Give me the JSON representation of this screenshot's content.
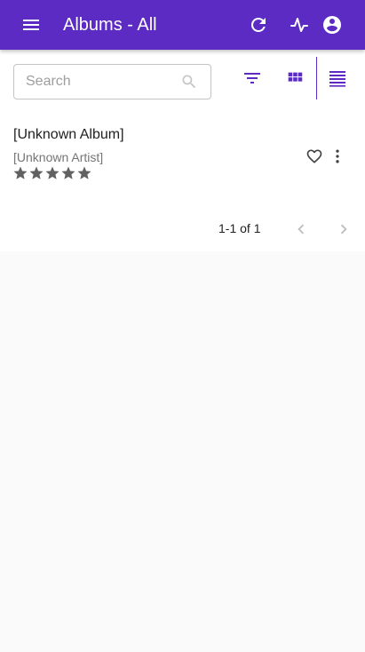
{
  "appbar": {
    "title": "Albums - All",
    "background": "#5b2bc4",
    "icons": [
      "menu-icon",
      "refresh-icon",
      "activity-icon",
      "account-circle-icon"
    ]
  },
  "toolbar": {
    "search_placeholder": "Search",
    "search_value": "",
    "icons": [
      "search-icon",
      "filter-icon",
      "grid-view-icon",
      "list-view-icon"
    ]
  },
  "albums": [
    {
      "title": "[Unknown Album]",
      "artist": "[Unknown Artist]",
      "rating_max": 5,
      "favorite": false
    }
  ],
  "pagination": {
    "label": "1-1 of 1",
    "prev_enabled": false,
    "next_enabled": false
  }
}
